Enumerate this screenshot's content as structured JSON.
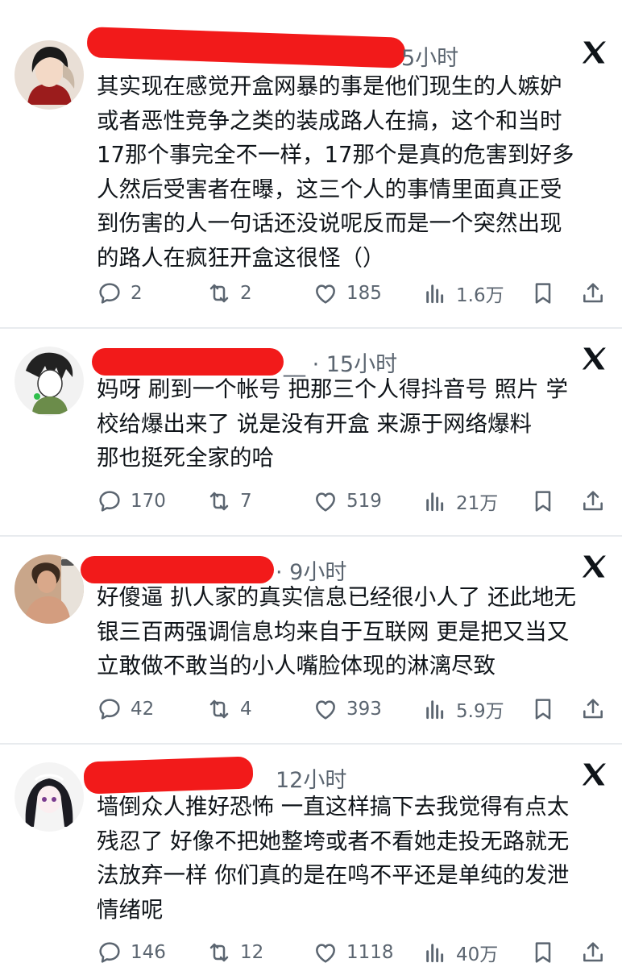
{
  "tweets": [
    {
      "time": "5小时",
      "lines": [
        "其实现在感觉开盒网暴的事是他们现生的人嫉妒",
        "或者恶性竞争之类的装成路人在搞，这个和当时",
        "17那个事完全不一样，17那个是真的危害到好多",
        "人然后受害者在曝，这三个人的事情里面真正受",
        "到伤害的人一句话还没说呢反而是一个突然出现",
        "的路人在疯狂开盒这很怪（）"
      ],
      "replies": "2",
      "retweets": "2",
      "likes": "185",
      "views": "1.6万"
    },
    {
      "time": "__ · 15小时",
      "lines": [
        "妈呀 刷到一个帐号 把那三个人得抖音号 照片 学",
        "校给爆出来了 说是没有开盒 来源于网络爆料",
        "那也挺死全家的哈"
      ],
      "replies": "170",
      "retweets": "7",
      "likes": "519",
      "views": "21万"
    },
    {
      "time": "· 9小时",
      "lines": [
        "好傻逼 扒人家的真实信息已经很小人了 还此地无",
        "银三百两强调信息均来自于互联网 更是把又当又",
        "立敢做不敢当的小人嘴脸体现的淋漓尽致"
      ],
      "replies": "42",
      "retweets": "4",
      "likes": "393",
      "views": "5.9万"
    },
    {
      "time": "12小时",
      "lines": [
        "墙倒众人推好恐怖 一直这样搞下去我觉得有点太",
        "残忍了 好像不把她整垮或者不看她走投无路就无",
        "法放弃一样 你们真的是在鸣不平还是单纯的发泄",
        "情绪呢"
      ],
      "replies": "146",
      "retweets": "12",
      "likes": "1118",
      "views": "40万"
    }
  ],
  "colors": {
    "text": "#0f1419",
    "muted": "#5b6570",
    "redact": "#f21a1a",
    "divider": "#e8ebee"
  },
  "icons": [
    "reply-icon",
    "retweet-icon",
    "like-icon",
    "views-icon",
    "bookmark-icon",
    "share-icon",
    "x-logo-icon"
  ]
}
